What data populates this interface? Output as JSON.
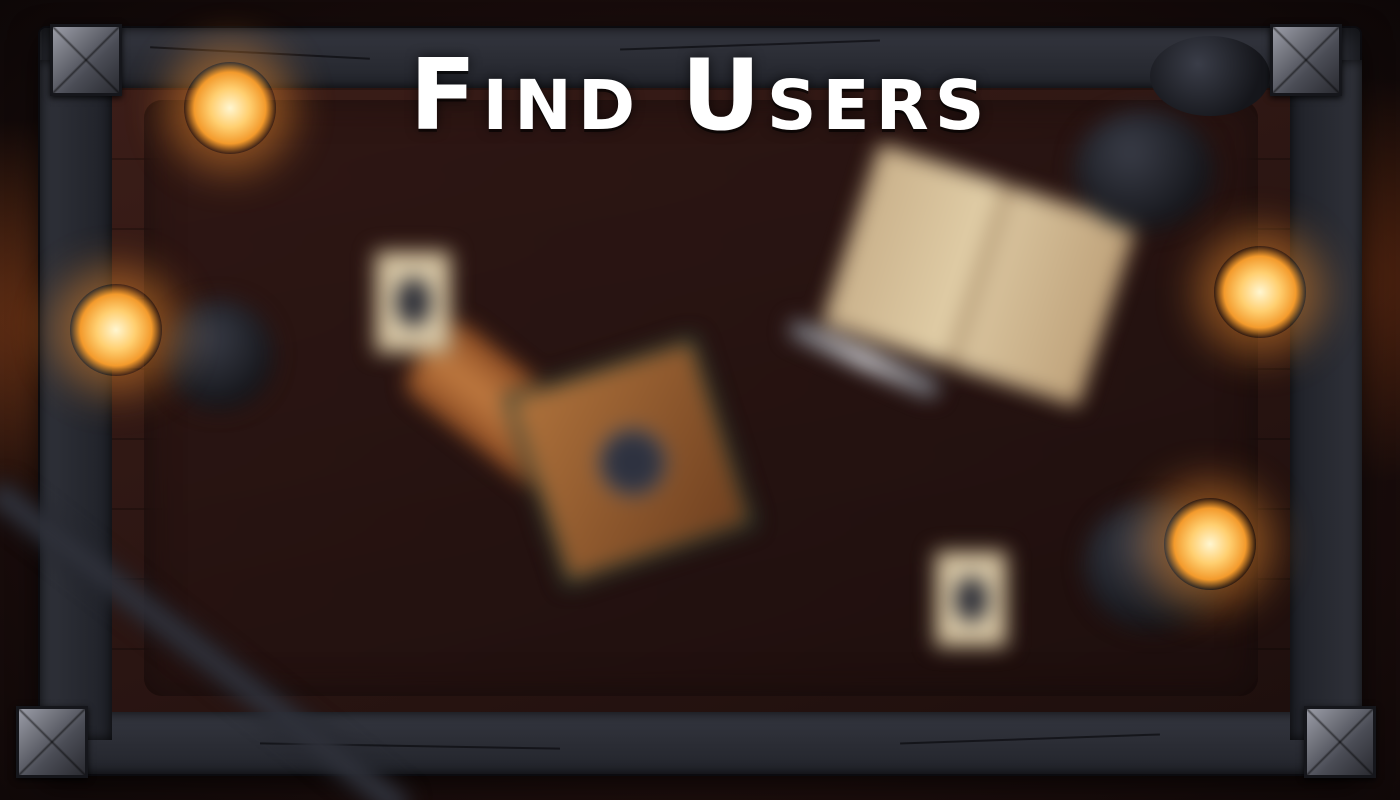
{
  "header": {
    "title": "Find Users"
  },
  "theme": {
    "title_color": "#ffffff",
    "frame_color": "#2c2e36",
    "table_color": "#2a1512",
    "candle_glow": "#ffcf70"
  },
  "decor_icons": [
    "candle-icon",
    "sword-icon",
    "book-icon",
    "card-icon",
    "shield-box-icon",
    "pot-icon"
  ]
}
